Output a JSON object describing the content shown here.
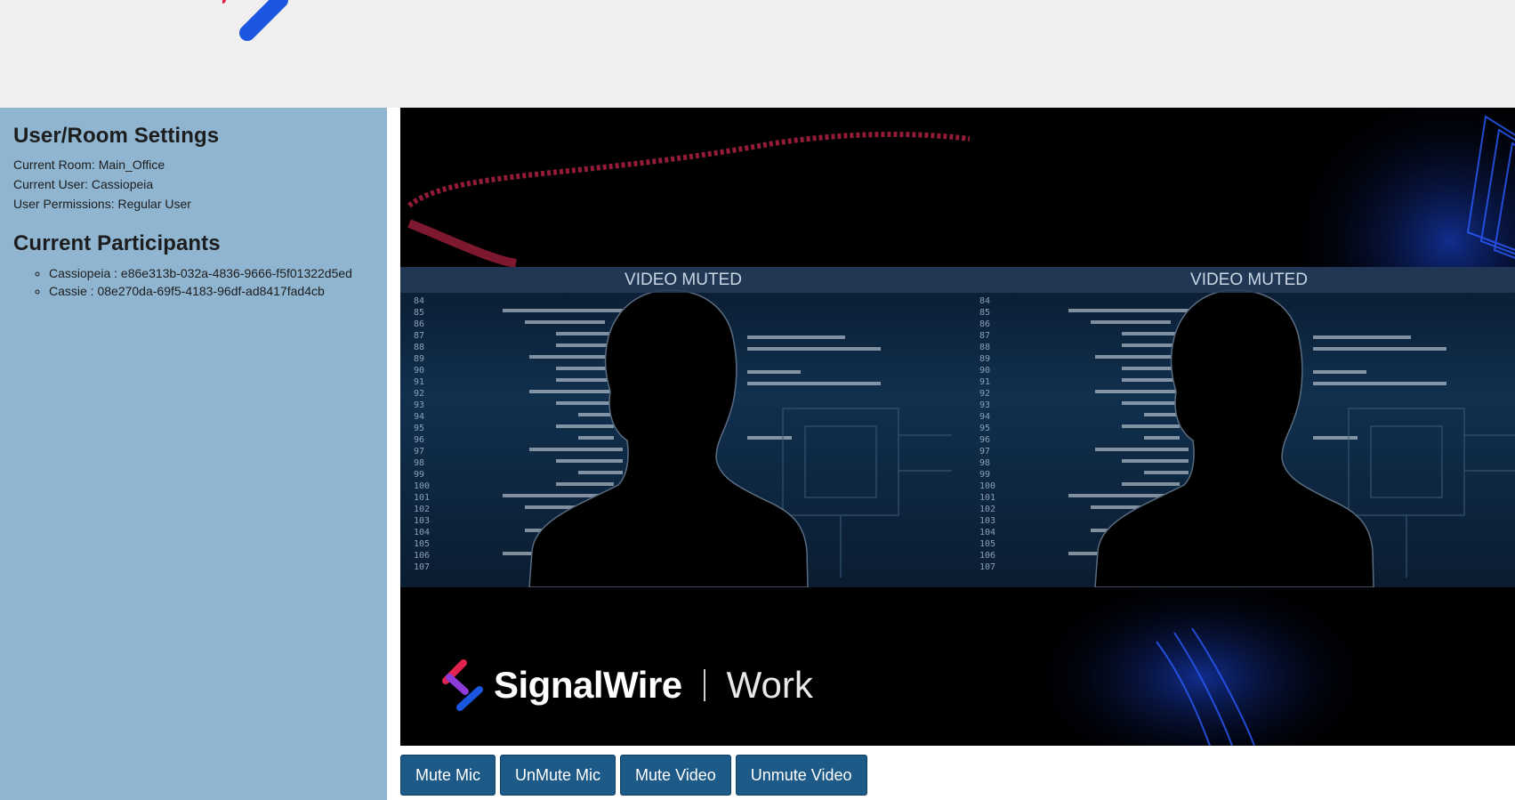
{
  "sidebar": {
    "settings_title": "User/Room Settings",
    "current_room": "Current Room: Main_Office",
    "current_user": "Current User: Cassiopeia",
    "user_permissions": "User Permissions: Regular User",
    "participants_title": "Current Participants",
    "participants": [
      "Cassiopeia : e86e313b-032a-4836-9666-f5f01322d5ed",
      "Cassie : 08e270da-69f5-4183-96df-ad8417fad4cb"
    ]
  },
  "video": {
    "tiles": [
      {
        "label": "VIDEO MUTED"
      },
      {
        "label": "VIDEO MUTED"
      }
    ],
    "brand_name": "SignalWire",
    "brand_product": "Work"
  },
  "controls": {
    "mute_mic": "Mute Mic",
    "unmute_mic": "UnMute Mic",
    "mute_video": "Mute Video",
    "unmute_video": "Unmute Video"
  },
  "colors": {
    "header_bg": "#efefef",
    "sidebar_bg": "#8fb5d0",
    "button_bg": "#1d5a88",
    "logo_accent": "#1a56e0"
  },
  "icons": {
    "header_logo": "signalwire-logo-mark-icon",
    "brand_logo": "signalwire-logo-icon",
    "avatar": "person-silhouette-icon"
  }
}
